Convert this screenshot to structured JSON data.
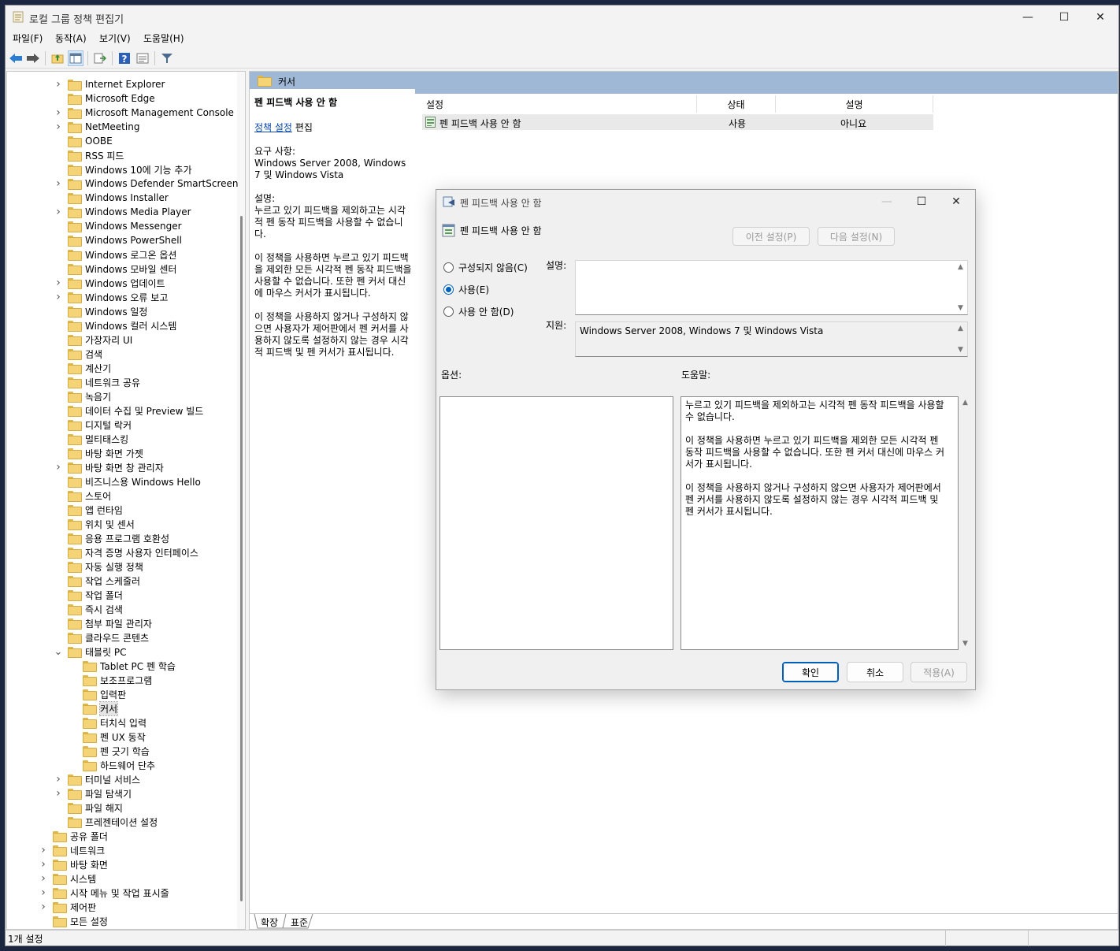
{
  "window": {
    "title": "로컬 그룹 정책 편집기"
  },
  "menu": [
    "파일(F)",
    "동작(A)",
    "보기(V)",
    "도움말(H)"
  ],
  "tree": [
    {
      "label": "Internet Explorer",
      "depth": 2,
      "exp": true
    },
    {
      "label": "Microsoft Edge",
      "depth": 2,
      "exp": false
    },
    {
      "label": "Microsoft Management Console",
      "depth": 2,
      "exp": true
    },
    {
      "label": "NetMeeting",
      "depth": 2,
      "exp": true
    },
    {
      "label": "OOBE",
      "depth": 2,
      "exp": false
    },
    {
      "label": "RSS 피드",
      "depth": 2,
      "exp": false
    },
    {
      "label": "Windows 10에 기능 추가",
      "depth": 2,
      "exp": false
    },
    {
      "label": "Windows Defender SmartScreen",
      "depth": 2,
      "exp": true
    },
    {
      "label": "Windows Installer",
      "depth": 2,
      "exp": false
    },
    {
      "label": "Windows Media Player",
      "depth": 2,
      "exp": true
    },
    {
      "label": "Windows Messenger",
      "depth": 2,
      "exp": false
    },
    {
      "label": "Windows PowerShell",
      "depth": 2,
      "exp": false
    },
    {
      "label": "Windows 로그온 옵션",
      "depth": 2,
      "exp": false
    },
    {
      "label": "Windows 모바일 센터",
      "depth": 2,
      "exp": false
    },
    {
      "label": "Windows 업데이트",
      "depth": 2,
      "exp": true
    },
    {
      "label": "Windows 오류 보고",
      "depth": 2,
      "exp": true
    },
    {
      "label": "Windows 일정",
      "depth": 2,
      "exp": false
    },
    {
      "label": "Windows 컬러 시스템",
      "depth": 2,
      "exp": false
    },
    {
      "label": "가장자리 UI",
      "depth": 2,
      "exp": false
    },
    {
      "label": "검색",
      "depth": 2,
      "exp": false
    },
    {
      "label": "계산기",
      "depth": 2,
      "exp": false
    },
    {
      "label": "네트워크 공유",
      "depth": 2,
      "exp": false
    },
    {
      "label": "녹음기",
      "depth": 2,
      "exp": false
    },
    {
      "label": "데이터 수집 및 Preview 빌드",
      "depth": 2,
      "exp": false
    },
    {
      "label": "디지털 락커",
      "depth": 2,
      "exp": false
    },
    {
      "label": "멀티태스킹",
      "depth": 2,
      "exp": false
    },
    {
      "label": "바탕 화면 가젯",
      "depth": 2,
      "exp": false
    },
    {
      "label": "바탕 화면 창 관리자",
      "depth": 2,
      "exp": true
    },
    {
      "label": "비즈니스용 Windows Hello",
      "depth": 2,
      "exp": false
    },
    {
      "label": "스토어",
      "depth": 2,
      "exp": false
    },
    {
      "label": "앱 런타임",
      "depth": 2,
      "exp": false
    },
    {
      "label": "위치 및 센서",
      "depth": 2,
      "exp": false
    },
    {
      "label": "응용 프로그램 호환성",
      "depth": 2,
      "exp": false
    },
    {
      "label": "자격 증명 사용자 인터페이스",
      "depth": 2,
      "exp": false
    },
    {
      "label": "자동 실행 정책",
      "depth": 2,
      "exp": false
    },
    {
      "label": "작업 스케줄러",
      "depth": 2,
      "exp": false
    },
    {
      "label": "작업 폴더",
      "depth": 2,
      "exp": false
    },
    {
      "label": "즉시 검색",
      "depth": 2,
      "exp": false
    },
    {
      "label": "첨부 파일 관리자",
      "depth": 2,
      "exp": false
    },
    {
      "label": "클라우드 콘텐츠",
      "depth": 2,
      "exp": false
    },
    {
      "label": "태블릿 PC",
      "depth": 2,
      "exp": "open"
    },
    {
      "label": "Tablet PC 펜 학습",
      "depth": 3,
      "exp": false
    },
    {
      "label": "보조프로그램",
      "depth": 3,
      "exp": false
    },
    {
      "label": "입력판",
      "depth": 3,
      "exp": false
    },
    {
      "label": "커서",
      "depth": 3,
      "exp": false,
      "selected": true
    },
    {
      "label": "터치식 입력",
      "depth": 3,
      "exp": false
    },
    {
      "label": "펜 UX 동작",
      "depth": 3,
      "exp": false
    },
    {
      "label": "펜 긋기 학습",
      "depth": 3,
      "exp": false
    },
    {
      "label": "하드웨어 단추",
      "depth": 3,
      "exp": false
    },
    {
      "label": "터미널 서비스",
      "depth": 2,
      "exp": true
    },
    {
      "label": "파일 탐색기",
      "depth": 2,
      "exp": true
    },
    {
      "label": "파일 해지",
      "depth": 2,
      "exp": false
    },
    {
      "label": "프레젠테이션 설정",
      "depth": 2,
      "exp": false
    },
    {
      "label": "공유 폴더",
      "depth": 1,
      "exp": false
    },
    {
      "label": "네트워크",
      "depth": 1,
      "exp": true
    },
    {
      "label": "바탕 화면",
      "depth": 1,
      "exp": true
    },
    {
      "label": "시스템",
      "depth": 1,
      "exp": true
    },
    {
      "label": "시작 메뉴 및 작업 표시줄",
      "depth": 1,
      "exp": true
    },
    {
      "label": "제어판",
      "depth": 1,
      "exp": true
    },
    {
      "label": "모든 설정",
      "depth": 1,
      "exp": false
    }
  ],
  "right": {
    "header": "커서",
    "ext": {
      "title": "펜 피드백 사용 안 함",
      "link": "정책 설정",
      "link_suffix": " 편집",
      "req_label": "요구 사항:",
      "req_value": "Windows Server 2008, Windows 7 및 Windows Vista",
      "desc_label": "설명:",
      "p1": "누르고 있기 피드백을 제외하고는 시각적 펜 동작 피드백을 사용할 수 없습니다.",
      "p2": "이 정책을 사용하면 누르고 있기 피드백을 제외한 모든 시각적 펜 동작 피드백을 사용할 수 없습니다.  또한 펜 커서 대신에 마우스 커서가 표시됩니다.",
      "p3": "이 정책을 사용하지 않거나 구성하지 않으면 사용자가 제어판에서 펜 커서를 사용하지 않도록 설정하지 않는 경우 시각적 피드백 및 펜 커서가 표시됩니다."
    },
    "columns": [
      "설정",
      "상태",
      "설명"
    ],
    "row": {
      "name": "펜 피드백 사용 안 함",
      "state": "사용",
      "comment": "아니요"
    },
    "tabs": [
      "확장",
      "표준"
    ]
  },
  "status": "1개 설정",
  "dialog": {
    "title": "펜 피드백 사용 안 함",
    "heading": "펜 피드백 사용 안 함",
    "prev": "이전 설정(P)",
    "next": "다음 설정(N)",
    "radio_not_configured": "구성되지 않음(C)",
    "radio_enabled": "사용(E)",
    "radio_disabled": "사용 안 함(D)",
    "comment_label": "설명:",
    "supported_label": "지원:",
    "supported_value": "Windows Server 2008, Windows 7 및 Windows Vista",
    "options_label": "옵션:",
    "help_label": "도움말:",
    "help_p1": "누르고 있기 피드백을 제외하고는 시각적 펜 동작 피드백을 사용할 수 없습니다.",
    "help_p2": "이 정책을 사용하면 누르고 있기 피드백을 제외한 모든 시각적 펜 동작 피드백을 사용할 수 없습니다.  또한 펜 커서 대신에 마우스 커서가 표시됩니다.",
    "help_p3": "이 정책을 사용하지 않거나 구성하지 않으면 사용자가 제어판에서 펜 커서를 사용하지 않도록 설정하지 않는 경우 시각적 피드백 및 펜 커서가 표시됩니다.",
    "ok": "확인",
    "cancel": "취소",
    "apply": "적용(A)"
  }
}
